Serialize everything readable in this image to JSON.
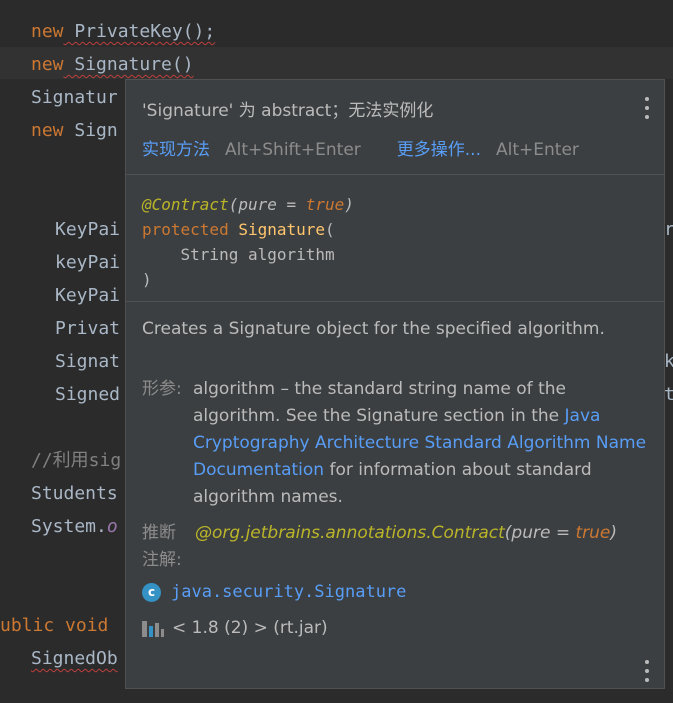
{
  "editor": {
    "lines": [
      {
        "kw": "new",
        "rest": " PrivateKey();"
      },
      {
        "kw": "new",
        "rest": " Signature()"
      },
      {
        "text": "Signatur"
      },
      {
        "kw": "new",
        "rest": " Sign"
      },
      {
        "text": "KeyPai"
      },
      {
        "text": "keyPai"
      },
      {
        "text": "KeyPai"
      },
      {
        "text": "Privat"
      },
      {
        "text": "Signat"
      },
      {
        "text": "Signed"
      },
      {
        "comment": "//利用sig"
      },
      {
        "text": "Students"
      },
      {
        "pre": "System.",
        "ital": "o"
      },
      {
        "kw": "ublic void"
      },
      {
        "text": "SignedOb"
      }
    ],
    "right_fragments": [
      "r",
      "k",
      "t"
    ]
  },
  "popup": {
    "title": "'Signature' 为 abstract；无法实例化",
    "actions": {
      "implement_label": "实现方法",
      "implement_shortcut": "Alt+Shift+Enter",
      "more_label": "更多操作...",
      "more_shortcut": "Alt+Enter"
    },
    "code": {
      "annotation": "@Contract",
      "annotation_args_open": "(pure = ",
      "annotation_value": "true",
      "annotation_args_close": ")",
      "modifier": "protected",
      "name": "Signature",
      "paren_open": "(",
      "param_line": "    String algorithm",
      "paren_close": ")"
    },
    "description": "Creates a Signature object for the specified algorithm.",
    "params": {
      "label": "形参:",
      "text_1": "algorithm – the standard string name of the algorithm. See the Signature section in the ",
      "link": "Java Cryptography Architecture Standard Algorithm Name Documentation",
      "text_2": " for information about standard algorithm names."
    },
    "inferred": {
      "label": "推断注解:",
      "annotation": "@org.jetbrains.annotations.Contract",
      "args_open": "(pure = ",
      "value": "true",
      "args_close": ")"
    },
    "class_ref": {
      "icon_letter": "c",
      "name": "java.security.Signature"
    },
    "library": {
      "text": "< 1.8 (2) > (rt.jar)"
    }
  },
  "colors": {
    "background": "#2b2b2b",
    "popup_bg": "#3c3f41",
    "keyword": "#cc7832",
    "link": "#589df6",
    "annotation": "#bbb529",
    "text": "#a9b7c6"
  }
}
